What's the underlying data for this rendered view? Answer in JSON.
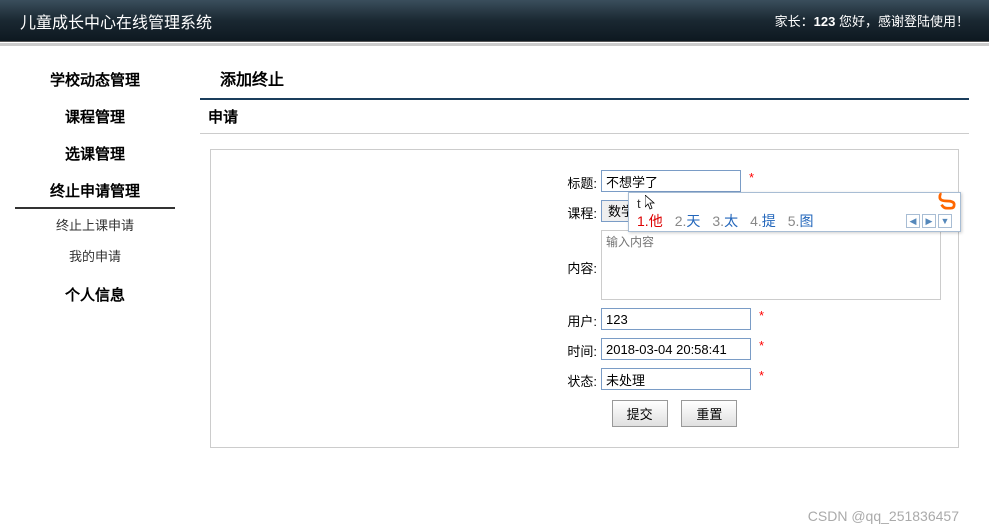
{
  "header": {
    "title": "儿童成长中心在线管理系统",
    "welcome_prefix": "家长：",
    "username": "123",
    "welcome_suffix": " 您好，感谢登陆使用！"
  },
  "sidebar": {
    "items": [
      {
        "label": "学校动态管理",
        "active": false
      },
      {
        "label": "课程管理",
        "active": false
      },
      {
        "label": "选课管理",
        "active": false
      },
      {
        "label": "终止申请管理",
        "active": true
      }
    ],
    "subitems": [
      {
        "label": "终止上课申请"
      },
      {
        "label": "我的申请"
      }
    ],
    "personal": "个人信息"
  },
  "content": {
    "title": "添加终止",
    "subtitle": "申请"
  },
  "form": {
    "title_label": "标题:",
    "title_value": "不想学了",
    "course_label": "课程:",
    "course_value": "数学拼搭",
    "content_label": "内容:",
    "content_placeholder": "输入内容",
    "user_label": "用户:",
    "user_value": "123",
    "time_label": "时间:",
    "time_value": "2018-03-04 20:58:41",
    "status_label": "状态:",
    "status_value": "未处理",
    "submit_label": "提交",
    "reset_label": "重置",
    "required_mark": "*"
  },
  "ime": {
    "input_text": "t",
    "candidates": [
      {
        "num": "1.",
        "word": "他"
      },
      {
        "num": "2.",
        "word": "天"
      },
      {
        "num": "3.",
        "word": "太"
      },
      {
        "num": "4.",
        "word": "提"
      },
      {
        "num": "5.",
        "word": "图"
      }
    ],
    "nav_prev": "◀",
    "nav_next": "▶",
    "nav_down": "▼"
  },
  "watermark": "CSDN @qq_251836457"
}
